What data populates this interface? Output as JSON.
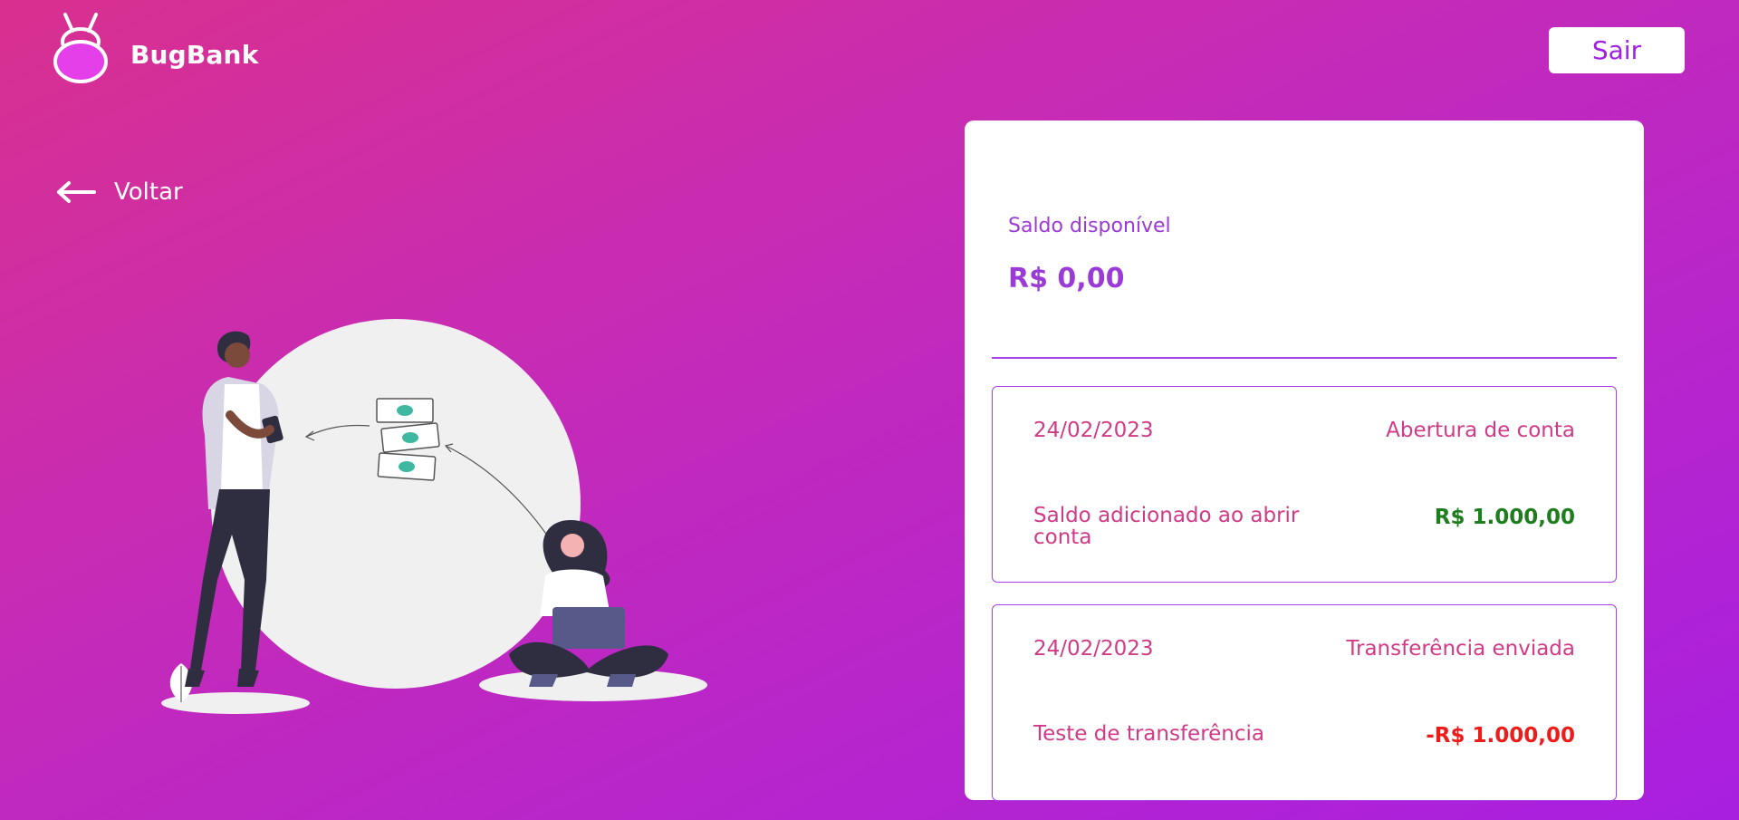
{
  "header": {
    "brand": "BugBank",
    "logout_label": "Sair"
  },
  "nav": {
    "back_label": "Voltar"
  },
  "balance": {
    "label": "Saldo disponível",
    "value": "R$ 0,00"
  },
  "transactions": [
    {
      "date": "24/02/2023",
      "type": "Abertura de conta",
      "description": "Saldo adicionado ao abrir conta",
      "amount": "R$ 1.000,00",
      "amount_color": "#1e7e1e"
    },
    {
      "date": "24/02/2023",
      "type": "Transferência enviada",
      "description": "Teste de transferência",
      "amount": "-R$ 1.000,00",
      "amount_color": "#ee1b1b"
    }
  ],
  "colors": {
    "accent": "#a642e6",
    "text_pink": "#d03a86",
    "positive": "#1e7e1e",
    "negative": "#ee1b1b"
  }
}
